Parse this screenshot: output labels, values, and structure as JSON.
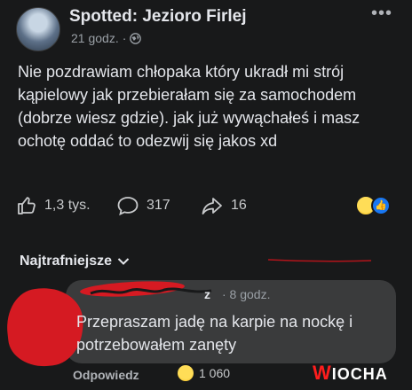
{
  "post": {
    "page_name": "Spotted: Jezioro Firlej",
    "time": "21 godz.",
    "separator": "·",
    "more_icon": "more-horizontal-icon",
    "privacy_icon": "globe-icon",
    "text": "Nie pozdrawiam chłopaka który ukradł mi strój kąpielowy jak przebierałam się za samochodem (dobrze wiesz gdzie). jak już wywąchałeś i masz ochotę oddać to odezwij się jakos xd"
  },
  "actions": {
    "likes": "1,3 tys.",
    "comments": "317",
    "shares": "16",
    "reactions": [
      "haha",
      "like"
    ]
  },
  "comments_section": {
    "sort_label": "Najtrafniejsze",
    "comment": {
      "author_visible_tail": "z",
      "time": "· 8 godz.",
      "text": "Przepraszam jadę na karpie na nockę i potrzebowałem zanęty",
      "reply_label": "Odpowiedz",
      "reaction_count": "1 060"
    }
  },
  "watermark": {
    "prefix": "W",
    "rest": "IOCHA"
  },
  "colors": {
    "background": "#18191a",
    "bubble": "#3a3b3c",
    "text": "#e4e6eb",
    "muted": "#9aa0a6",
    "redaction": "#d51a22",
    "like_blue": "#1877f2"
  }
}
